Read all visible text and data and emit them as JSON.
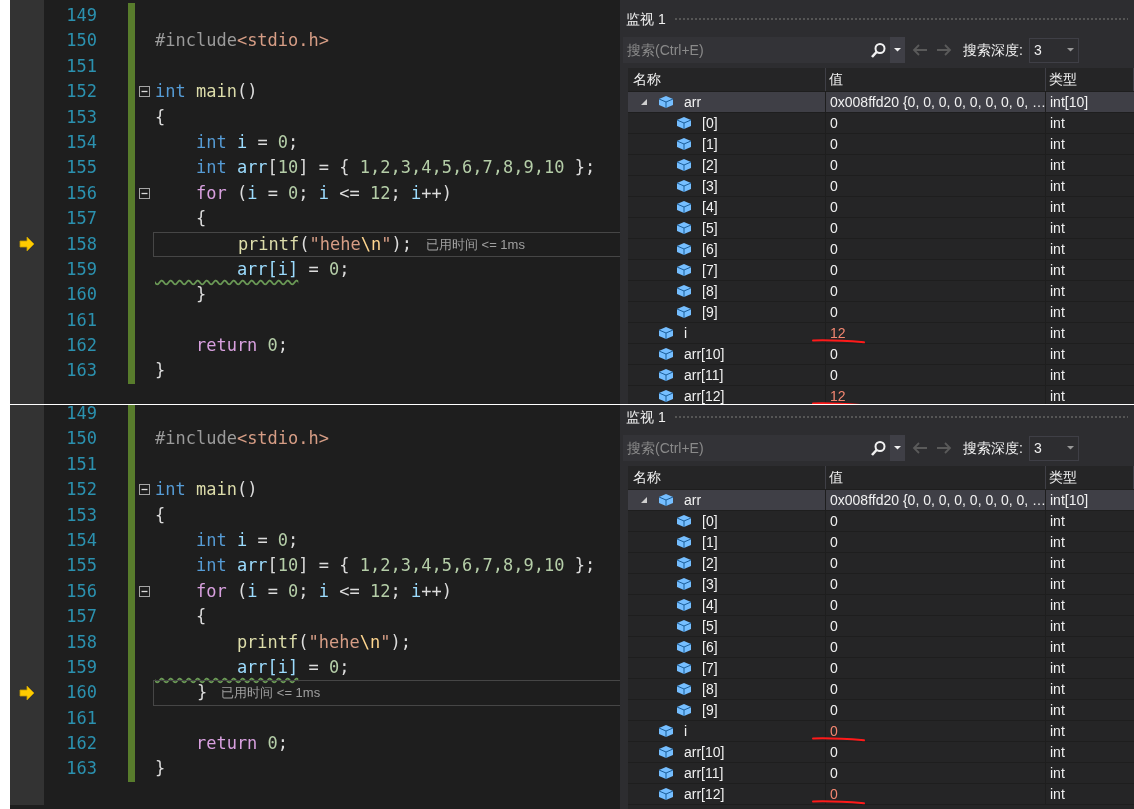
{
  "panels": [
    {
      "editor": {
        "hint": "已用时间 <= 1ms",
        "lines": [
          {
            "number": "149",
            "current": false,
            "fold": false
          },
          {
            "number": "150",
            "current": false,
            "fold": false,
            "tokens": [
              {
                "t": "#include",
                "kind": "pre"
              },
              {
                "t": "<stdio.h>",
                "kind": "inc"
              }
            ]
          },
          {
            "number": "151",
            "current": false,
            "fold": false
          },
          {
            "number": "152",
            "current": false,
            "fold": true,
            "tokens": [
              {
                "t": "int",
                "kind": "kw"
              },
              {
                "t": " main",
                "kind": "fn"
              },
              {
                "t": "()",
                "kind": "punc"
              }
            ]
          },
          {
            "number": "153",
            "current": false,
            "fold": false,
            "tokens": [
              {
                "t": "{",
                "kind": "punc"
              }
            ]
          },
          {
            "number": "154",
            "current": false,
            "fold": false,
            "tokens": [
              {
                "t": "    int",
                "kind": "kw"
              },
              {
                "t": " i",
                "kind": "var"
              },
              {
                "t": " = ",
                "kind": "punc"
              },
              {
                "t": "0",
                "kind": "num"
              },
              {
                "t": ";",
                "kind": "punc"
              }
            ]
          },
          {
            "number": "155",
            "current": false,
            "fold": false,
            "tokens": [
              {
                "t": "    int",
                "kind": "kw"
              },
              {
                "t": " arr",
                "kind": "var"
              },
              {
                "t": "[",
                "kind": "punc"
              },
              {
                "t": "10",
                "kind": "num"
              },
              {
                "t": "] = { ",
                "kind": "punc"
              },
              {
                "t": "1,2,3,4,5,6,7,8,9,10",
                "kind": "num"
              },
              {
                "t": " };",
                "kind": "punc"
              }
            ]
          },
          {
            "number": "156",
            "current": false,
            "fold": true,
            "tokens": [
              {
                "t": "    for",
                "kind": "ctrl"
              },
              {
                "t": " (",
                "kind": "punc"
              },
              {
                "t": "i",
                "kind": "var"
              },
              {
                "t": " = ",
                "kind": "punc"
              },
              {
                "t": "0",
                "kind": "num"
              },
              {
                "t": "; ",
                "kind": "punc"
              },
              {
                "t": "i",
                "kind": "var"
              },
              {
                "t": " <= ",
                "kind": "punc"
              },
              {
                "t": "12",
                "kind": "num"
              },
              {
                "t": "; ",
                "kind": "punc"
              },
              {
                "t": "i",
                "kind": "var"
              },
              {
                "t": "++)",
                "kind": "punc"
              }
            ]
          },
          {
            "number": "157",
            "current": false,
            "fold": false,
            "tokens": [
              {
                "t": "    {",
                "kind": "punc"
              }
            ]
          },
          {
            "number": "158",
            "current": true,
            "fold": false,
            "tokens": [
              {
                "t": "        printf",
                "kind": "fn"
              },
              {
                "t": "(",
                "kind": "punc"
              },
              {
                "t": "\"hehe",
                "kind": "str"
              },
              {
                "t": "\\n",
                "kind": "esc"
              },
              {
                "t": "\"",
                "kind": "str"
              },
              {
                "t": ");",
                "kind": "punc"
              }
            ]
          },
          {
            "number": "159",
            "current": false,
            "fold": false,
            "tokens": [
              {
                "t": "        arr[i]",
                "kind": "warn"
              },
              {
                "t": " = ",
                "kind": "punc"
              },
              {
                "t": "0",
                "kind": "num"
              },
              {
                "t": ";",
                "kind": "punc"
              }
            ]
          },
          {
            "number": "160",
            "current": false,
            "fold": false,
            "tokens": [
              {
                "t": "    }",
                "kind": "punc"
              }
            ]
          },
          {
            "number": "161",
            "current": false,
            "fold": false
          },
          {
            "number": "162",
            "current": false,
            "fold": false,
            "tokens": [
              {
                "t": "    return ",
                "kind": "ctrl"
              },
              {
                "t": "0",
                "kind": "num"
              },
              {
                "t": ";",
                "kind": "punc"
              }
            ]
          },
          {
            "number": "163",
            "current": false,
            "fold": false,
            "tokens": [
              {
                "t": "}",
                "kind": "punc"
              }
            ]
          }
        ]
      },
      "watch": {
        "title": "监视 1",
        "search": {
          "placeholder": "搜索(Ctrl+E)"
        },
        "depth_label": "搜索深度:",
        "depth_value": "3",
        "columns": [
          "名称",
          "值",
          "类型"
        ],
        "rows": [
          {
            "name": "arr",
            "value": "0x008ffd20 {0, 0, 0, 0, 0, 0, 0, 0, …",
            "type": "int[10]",
            "selected": true,
            "changed": false,
            "underlined": false,
            "expanded": true,
            "children": [
              {
                "name": "[0]",
                "value": "0",
                "type": "int",
                "selected": false,
                "changed": false,
                "underlined": false
              },
              {
                "name": "[1]",
                "value": "0",
                "type": "int",
                "selected": false,
                "changed": false,
                "underlined": false
              },
              {
                "name": "[2]",
                "value": "0",
                "type": "int",
                "selected": false,
                "changed": false,
                "underlined": false
              },
              {
                "name": "[3]",
                "value": "0",
                "type": "int",
                "selected": false,
                "changed": false,
                "underlined": false
              },
              {
                "name": "[4]",
                "value": "0",
                "type": "int",
                "selected": false,
                "changed": false,
                "underlined": false
              },
              {
                "name": "[5]",
                "value": "0",
                "type": "int",
                "selected": false,
                "changed": false,
                "underlined": false
              },
              {
                "name": "[6]",
                "value": "0",
                "type": "int",
                "selected": false,
                "changed": false,
                "underlined": false
              },
              {
                "name": "[7]",
                "value": "0",
                "type": "int",
                "selected": false,
                "changed": false,
                "underlined": false
              },
              {
                "name": "[8]",
                "value": "0",
                "type": "int",
                "selected": false,
                "changed": false,
                "underlined": false
              },
              {
                "name": "[9]",
                "value": "0",
                "type": "int",
                "selected": false,
                "changed": false,
                "underlined": false
              }
            ]
          },
          {
            "name": "i",
            "value": "12",
            "type": "int",
            "selected": false,
            "changed": true,
            "underlined": true
          },
          {
            "name": "arr[10]",
            "value": "0",
            "type": "int",
            "selected": false,
            "changed": false,
            "underlined": false
          },
          {
            "name": "arr[11]",
            "value": "0",
            "type": "int",
            "selected": false,
            "changed": false,
            "underlined": false
          },
          {
            "name": "arr[12]",
            "value": "12",
            "type": "int",
            "selected": false,
            "changed": true,
            "underlined": true
          }
        ]
      }
    },
    {
      "editor": {
        "hint": "已用时间 <= 1ms",
        "lines": [
          {
            "number": "149",
            "current": false,
            "fold": false
          },
          {
            "number": "150",
            "current": false,
            "fold": false,
            "tokens": [
              {
                "t": "#include",
                "kind": "pre"
              },
              {
                "t": "<stdio.h>",
                "kind": "inc"
              }
            ]
          },
          {
            "number": "151",
            "current": false,
            "fold": false
          },
          {
            "number": "152",
            "current": false,
            "fold": true,
            "tokens": [
              {
                "t": "int",
                "kind": "kw"
              },
              {
                "t": " main",
                "kind": "fn"
              },
              {
                "t": "()",
                "kind": "punc"
              }
            ]
          },
          {
            "number": "153",
            "current": false,
            "fold": false,
            "tokens": [
              {
                "t": "{",
                "kind": "punc"
              }
            ]
          },
          {
            "number": "154",
            "current": false,
            "fold": false,
            "tokens": [
              {
                "t": "    int",
                "kind": "kw"
              },
              {
                "t": " i",
                "kind": "var"
              },
              {
                "t": " = ",
                "kind": "punc"
              },
              {
                "t": "0",
                "kind": "num"
              },
              {
                "t": ";",
                "kind": "punc"
              }
            ]
          },
          {
            "number": "155",
            "current": false,
            "fold": false,
            "tokens": [
              {
                "t": "    int",
                "kind": "kw"
              },
              {
                "t": " arr",
                "kind": "var"
              },
              {
                "t": "[",
                "kind": "punc"
              },
              {
                "t": "10",
                "kind": "num"
              },
              {
                "t": "] = { ",
                "kind": "punc"
              },
              {
                "t": "1,2,3,4,5,6,7,8,9,10",
                "kind": "num"
              },
              {
                "t": " };",
                "kind": "punc"
              }
            ]
          },
          {
            "number": "156",
            "current": false,
            "fold": true,
            "tokens": [
              {
                "t": "    for",
                "kind": "ctrl"
              },
              {
                "t": " (",
                "kind": "punc"
              },
              {
                "t": "i",
                "kind": "var"
              },
              {
                "t": " = ",
                "kind": "punc"
              },
              {
                "t": "0",
                "kind": "num"
              },
              {
                "t": "; ",
                "kind": "punc"
              },
              {
                "t": "i",
                "kind": "var"
              },
              {
                "t": " <= ",
                "kind": "punc"
              },
              {
                "t": "12",
                "kind": "num"
              },
              {
                "t": "; ",
                "kind": "punc"
              },
              {
                "t": "i",
                "kind": "var"
              },
              {
                "t": "++)",
                "kind": "punc"
              }
            ]
          },
          {
            "number": "157",
            "current": false,
            "fold": false,
            "tokens": [
              {
                "t": "    {",
                "kind": "punc"
              }
            ]
          },
          {
            "number": "158",
            "current": false,
            "fold": false,
            "tokens": [
              {
                "t": "        printf",
                "kind": "fn"
              },
              {
                "t": "(",
                "kind": "punc"
              },
              {
                "t": "\"hehe",
                "kind": "str"
              },
              {
                "t": "\\n",
                "kind": "esc"
              },
              {
                "t": "\"",
                "kind": "str"
              },
              {
                "t": ");",
                "kind": "punc"
              }
            ]
          },
          {
            "number": "159",
            "current": false,
            "fold": false,
            "tokens": [
              {
                "t": "        arr[i]",
                "kind": "warn"
              },
              {
                "t": " = ",
                "kind": "punc"
              },
              {
                "t": "0",
                "kind": "num"
              },
              {
                "t": ";",
                "kind": "punc"
              }
            ]
          },
          {
            "number": "160",
            "current": true,
            "fold": false,
            "tokens": [
              {
                "t": "    }",
                "kind": "punc"
              }
            ]
          },
          {
            "number": "161",
            "current": false,
            "fold": false
          },
          {
            "number": "162",
            "current": false,
            "fold": false,
            "tokens": [
              {
                "t": "    return ",
                "kind": "ctrl"
              },
              {
                "t": "0",
                "kind": "num"
              },
              {
                "t": ";",
                "kind": "punc"
              }
            ]
          },
          {
            "number": "163",
            "current": false,
            "fold": false,
            "tokens": [
              {
                "t": "}",
                "kind": "punc"
              }
            ]
          }
        ]
      },
      "watch": {
        "title": "监视 1",
        "search": {
          "placeholder": "搜索(Ctrl+E)"
        },
        "depth_label": "搜索深度:",
        "depth_value": "3",
        "columns": [
          "名称",
          "值",
          "类型"
        ],
        "rows": [
          {
            "name": "arr",
            "value": "0x008ffd20 {0, 0, 0, 0, 0, 0, 0, 0, …",
            "type": "int[10]",
            "selected": true,
            "changed": false,
            "underlined": false,
            "expanded": true,
            "children": [
              {
                "name": "[0]",
                "value": "0",
                "type": "int",
                "selected": false,
                "changed": false,
                "underlined": false
              },
              {
                "name": "[1]",
                "value": "0",
                "type": "int",
                "selected": false,
                "changed": false,
                "underlined": false
              },
              {
                "name": "[2]",
                "value": "0",
                "type": "int",
                "selected": false,
                "changed": false,
                "underlined": false
              },
              {
                "name": "[3]",
                "value": "0",
                "type": "int",
                "selected": false,
                "changed": false,
                "underlined": false
              },
              {
                "name": "[4]",
                "value": "0",
                "type": "int",
                "selected": false,
                "changed": false,
                "underlined": false
              },
              {
                "name": "[5]",
                "value": "0",
                "type": "int",
                "selected": false,
                "changed": false,
                "underlined": false
              },
              {
                "name": "[6]",
                "value": "0",
                "type": "int",
                "selected": false,
                "changed": false,
                "underlined": false
              },
              {
                "name": "[7]",
                "value": "0",
                "type": "int",
                "selected": false,
                "changed": false,
                "underlined": false
              },
              {
                "name": "[8]",
                "value": "0",
                "type": "int",
                "selected": false,
                "changed": false,
                "underlined": false
              },
              {
                "name": "[9]",
                "value": "0",
                "type": "int",
                "selected": false,
                "changed": false,
                "underlined": false
              }
            ]
          },
          {
            "name": "i",
            "value": "0",
            "type": "int",
            "selected": false,
            "changed": true,
            "underlined": true
          },
          {
            "name": "arr[10]",
            "value": "0",
            "type": "int",
            "selected": false,
            "changed": false,
            "underlined": false
          },
          {
            "name": "arr[11]",
            "value": "0",
            "type": "int",
            "selected": false,
            "changed": false,
            "underlined": false
          },
          {
            "name": "arr[12]",
            "value": "0",
            "type": "int",
            "selected": false,
            "changed": true,
            "underlined": true
          }
        ]
      }
    }
  ]
}
